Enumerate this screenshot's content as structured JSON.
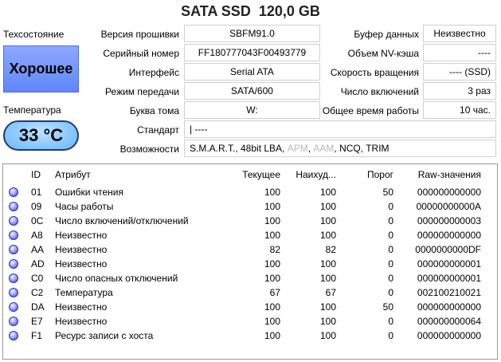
{
  "title": "SATA SSD  120,0 GB",
  "left": {
    "health_label": "Техсостояние",
    "health_value": "Хорошее",
    "temp_label": "Температура",
    "temp_value": "33 °C"
  },
  "info_left": [
    {
      "label": "Версия прошивки",
      "value": "SBFM91.0"
    },
    {
      "label": "Серийный номер",
      "value": "FF180777043F00493779"
    },
    {
      "label": "Интерфейс",
      "value": "Serial ATA"
    },
    {
      "label": "Режим передачи",
      "value": "SATA/600"
    },
    {
      "label": "Буква тома",
      "value": "W:"
    }
  ],
  "info_right": [
    {
      "label": "Буфер данных",
      "value": "Неизвестно"
    },
    {
      "label": "Объем NV-кэша",
      "value": "----"
    },
    {
      "label": "Скорость вращения",
      "value": "---- (SSD)"
    },
    {
      "label": "Число включений",
      "value": "3 раз"
    },
    {
      "label": "Общее время работы",
      "value": "10 час."
    }
  ],
  "standard": {
    "label": "Стандарт",
    "value": "| ----"
  },
  "features": {
    "label": "Возможности",
    "prefix": "S.M.A.R.T., 48bit LBA, ",
    "apm": "APM",
    "sep1": ", ",
    "aam": "AAM",
    "suffix": ", NCQ, TRIM"
  },
  "table": {
    "headers": {
      "id": "ID",
      "attr": "Атрибут",
      "cur": "Текущее",
      "worst": "Наихуд...",
      "thr": "Порог",
      "raw": "Raw-значения"
    },
    "rows": [
      {
        "id": "01",
        "attr": "Ошибки чтения",
        "cur": "100",
        "worst": "100",
        "thr": "50",
        "raw": "000000000000"
      },
      {
        "id": "09",
        "attr": "Часы работы",
        "cur": "100",
        "worst": "100",
        "thr": "0",
        "raw": "00000000000A"
      },
      {
        "id": "0C",
        "attr": "Число включений/отключений",
        "cur": "100",
        "worst": "100",
        "thr": "0",
        "raw": "000000000003"
      },
      {
        "id": "A8",
        "attr": "Неизвестно",
        "cur": "100",
        "worst": "100",
        "thr": "0",
        "raw": "000000000000"
      },
      {
        "id": "AA",
        "attr": "Неизвестно",
        "cur": "82",
        "worst": "82",
        "thr": "0",
        "raw": "0000000000DF"
      },
      {
        "id": "AD",
        "attr": "Неизвестно",
        "cur": "100",
        "worst": "100",
        "thr": "0",
        "raw": "000000000001"
      },
      {
        "id": "C0",
        "attr": "Число опасных отключений",
        "cur": "100",
        "worst": "100",
        "thr": "0",
        "raw": "000000000001"
      },
      {
        "id": "C2",
        "attr": "Температура",
        "cur": "67",
        "worst": "67",
        "thr": "0",
        "raw": "002100210021"
      },
      {
        "id": "DA",
        "attr": "Неизвестно",
        "cur": "100",
        "worst": "100",
        "thr": "50",
        "raw": "000000000000"
      },
      {
        "id": "E7",
        "attr": "Неизвестно",
        "cur": "100",
        "worst": "100",
        "thr": "0",
        "raw": "000000000064"
      },
      {
        "id": "F1",
        "attr": "Ресурс записи с хоста",
        "cur": "100",
        "worst": "100",
        "thr": "0",
        "raw": "000000000000"
      }
    ]
  },
  "colors": {
    "health_bg": "#6f91ff",
    "temp_bg": "#8ccaff",
    "status_dot": "#3a4ae0"
  }
}
